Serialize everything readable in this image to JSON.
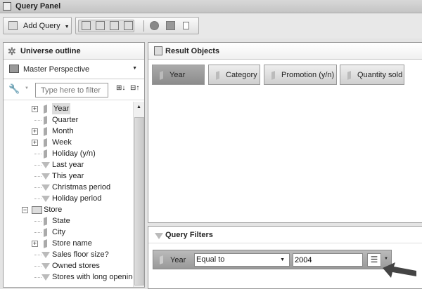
{
  "title": "Query Panel",
  "toolbar": {
    "add_query": "Add Query"
  },
  "universe": {
    "title": "Universe outline",
    "perspective": "Master Perspective",
    "filter_placeholder": "Type here to filter",
    "tree": [
      {
        "label": "Year",
        "type": "dim",
        "level": 2,
        "expand": "+",
        "selected": true
      },
      {
        "label": "Quarter",
        "type": "dim",
        "level": 2
      },
      {
        "label": "Month",
        "type": "dim",
        "level": 2,
        "expand": "+"
      },
      {
        "label": "Week",
        "type": "dim",
        "level": 2,
        "expand": "+"
      },
      {
        "label": "Holiday (y/n)",
        "type": "dim",
        "level": 2
      },
      {
        "label": "Last year",
        "type": "filter",
        "level": 2
      },
      {
        "label": "This year",
        "type": "filter",
        "level": 2
      },
      {
        "label": "Christmas period",
        "type": "filter",
        "level": 2
      },
      {
        "label": "Holiday period",
        "type": "filter",
        "level": 2
      },
      {
        "label": "Store",
        "type": "folder",
        "level": 1,
        "expand": "−"
      },
      {
        "label": "State",
        "type": "dim",
        "level": 2
      },
      {
        "label": "City",
        "type": "dim",
        "level": 2
      },
      {
        "label": "Store name",
        "type": "dim",
        "level": 2,
        "expand": "+"
      },
      {
        "label": "Sales floor size?",
        "type": "filter",
        "level": 2
      },
      {
        "label": "Owned stores",
        "type": "filter",
        "level": 2
      },
      {
        "label": "Stores with long opening hours",
        "type": "filter",
        "level": 2
      }
    ]
  },
  "result": {
    "title": "Result Objects",
    "objects": [
      "Year",
      "Category",
      "Promotion (y/n)",
      "Quantity sold"
    ]
  },
  "filters": {
    "title": "Query Filters",
    "object": "Year",
    "operator": "Equal to",
    "value": "2004"
  }
}
